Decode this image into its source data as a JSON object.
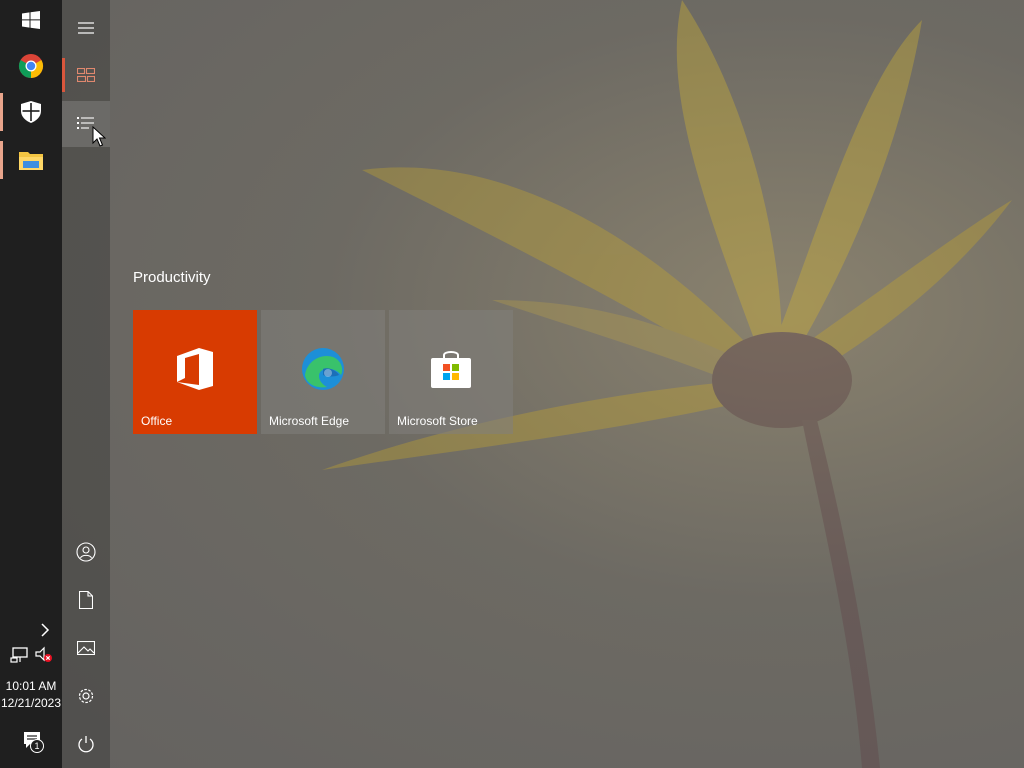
{
  "taskbar": {
    "start_icon": "windows-logo-icon",
    "apps": [
      {
        "name": "Google Chrome",
        "icon": "chrome-icon",
        "active": false
      },
      {
        "name": "Windows Security",
        "icon": "shield-icon",
        "active": true
      },
      {
        "name": "File Explorer",
        "icon": "folder-icon",
        "active": true
      }
    ],
    "tray": {
      "chevron_icon": "chevron-right-icon",
      "network_icon": "network-icon",
      "volume_icon": "volume-muted-icon"
    },
    "clock": {
      "time": "10:01 AM",
      "date": "12/21/2023"
    },
    "notifications": {
      "icon": "action-center-icon",
      "count": "1"
    }
  },
  "start_rail": {
    "items": [
      {
        "name": "expand",
        "icon": "hamburger-icon"
      },
      {
        "name": "pinned tiles",
        "icon": "tiles-icon",
        "selected": true
      },
      {
        "name": "all apps",
        "icon": "list-icon",
        "hover": true
      },
      {
        "name": "user account",
        "icon": "user-icon"
      },
      {
        "name": "documents",
        "icon": "document-icon"
      },
      {
        "name": "pictures",
        "icon": "pictures-icon"
      },
      {
        "name": "settings",
        "icon": "gear-icon"
      },
      {
        "name": "power",
        "icon": "power-icon"
      }
    ]
  },
  "tiles": {
    "group_title": "Productivity",
    "items": [
      {
        "label": "Office",
        "icon": "office-icon",
        "color": "#d83b01"
      },
      {
        "label": "Microsoft Edge",
        "icon": "edge-icon"
      },
      {
        "label": "Microsoft Store",
        "icon": "store-icon"
      }
    ]
  },
  "colors": {
    "accent": "#d83b01",
    "taskbar": "#1f1f1f",
    "active_indicator": "#e9a58c"
  }
}
